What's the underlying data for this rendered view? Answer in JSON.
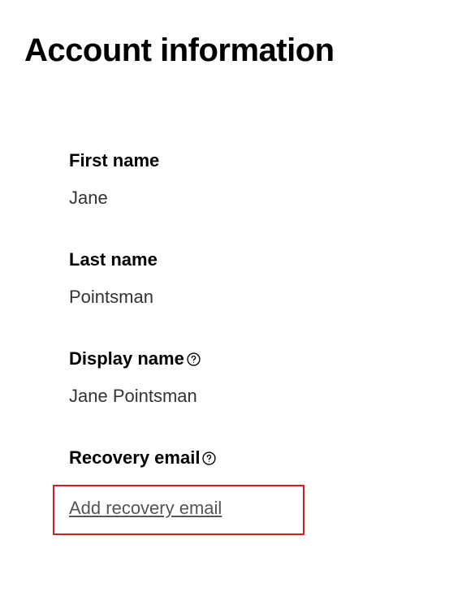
{
  "title": "Account information",
  "fields": {
    "firstName": {
      "label": "First name",
      "value": "Jane"
    },
    "lastName": {
      "label": "Last name",
      "value": "Pointsman"
    },
    "displayName": {
      "label": "Display name",
      "value": "Jane Pointsman"
    },
    "recoveryEmail": {
      "label": "Recovery email",
      "linkText": "Add recovery email"
    }
  }
}
